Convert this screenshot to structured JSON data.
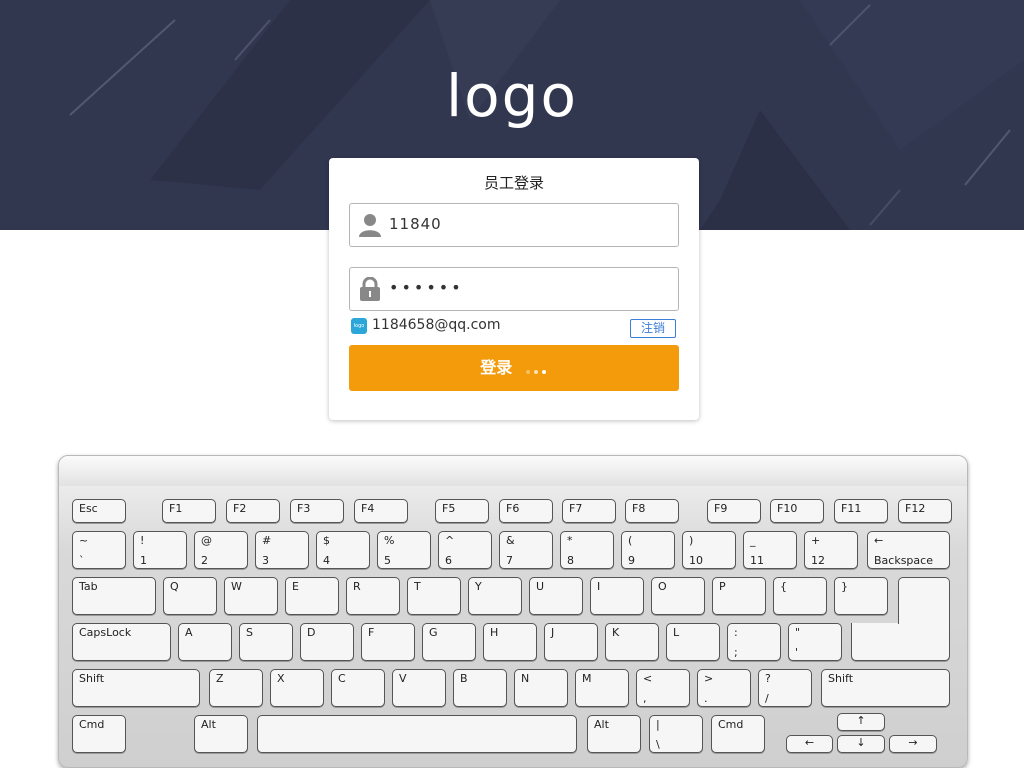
{
  "header": {
    "logo_text": "logo"
  },
  "login": {
    "title": "员工登录",
    "username_value": "11840",
    "password_mask": "••••••",
    "account_logo_text": "logo",
    "account_email": "1184658@qq.com",
    "logout_label": "注销",
    "submit_label": "登录"
  },
  "icons": {
    "user": "user-icon",
    "lock": "lock-icon",
    "loading": "loading-dots-icon"
  },
  "colors": {
    "banner": "#323750",
    "accent": "#f49b0c",
    "link": "#3d7ed9"
  },
  "keyboard": {
    "rows": [
      [
        {
          "top": "Esc",
          "name": "esc"
        },
        {
          "top": "F1",
          "name": "f1"
        },
        {
          "top": "F2",
          "name": "f2"
        },
        {
          "top": "F3",
          "name": "f3"
        },
        {
          "top": "F4",
          "name": "f4"
        },
        {
          "top": "F5",
          "name": "f5"
        },
        {
          "top": "F6",
          "name": "f6"
        },
        {
          "top": "F7",
          "name": "f7"
        },
        {
          "top": "F8",
          "name": "f8"
        },
        {
          "top": "F9",
          "name": "f9"
        },
        {
          "top": "F10",
          "name": "f10"
        },
        {
          "top": "F11",
          "name": "f11"
        },
        {
          "top": "F12",
          "name": "f12"
        }
      ],
      [
        {
          "top": "~",
          "bottom": "`",
          "name": "tilde"
        },
        {
          "top": "!",
          "bottom": "1",
          "name": "1"
        },
        {
          "top": "@",
          "bottom": "2",
          "name": "2"
        },
        {
          "top": "#",
          "bottom": "3",
          "name": "3"
        },
        {
          "top": "$",
          "bottom": "4",
          "name": "4"
        },
        {
          "top": "%",
          "bottom": "5",
          "name": "5"
        },
        {
          "top": "^",
          "bottom": "6",
          "name": "6"
        },
        {
          "top": "&",
          "bottom": "7",
          "name": "7"
        },
        {
          "top": "*",
          "bottom": "8",
          "name": "8"
        },
        {
          "top": "(",
          "bottom": "9",
          "name": "9"
        },
        {
          "top": ")",
          "bottom": "10",
          "name": "10"
        },
        {
          "top": "_",
          "bottom": "11",
          "name": "11"
        },
        {
          "top": "+",
          "bottom": "12",
          "name": "12"
        },
        {
          "top": "←",
          "bottom": "Backspace",
          "name": "backspace"
        }
      ],
      [
        {
          "top": "Tab",
          "name": "tab"
        },
        {
          "top": "Q",
          "name": "q"
        },
        {
          "top": "W",
          "name": "w"
        },
        {
          "top": "E",
          "name": "e"
        },
        {
          "top": "R",
          "name": "r"
        },
        {
          "top": "T",
          "name": "t"
        },
        {
          "top": "Y",
          "name": "y"
        },
        {
          "top": "U",
          "name": "u"
        },
        {
          "top": "I",
          "name": "i"
        },
        {
          "top": "O",
          "name": "o"
        },
        {
          "top": "P",
          "name": "p"
        },
        {
          "top": "{",
          "name": "lbrace"
        },
        {
          "top": "}",
          "name": "rbrace"
        },
        {
          "top": "",
          "name": "enter"
        }
      ],
      [
        {
          "top": "CapsLock",
          "name": "capslock"
        },
        {
          "top": "A",
          "name": "a"
        },
        {
          "top": "S",
          "name": "s"
        },
        {
          "top": "D",
          "name": "d"
        },
        {
          "top": "F",
          "name": "f"
        },
        {
          "top": "G",
          "name": "g"
        },
        {
          "top": "H",
          "name": "h"
        },
        {
          "top": "J",
          "name": "j"
        },
        {
          "top": "K",
          "name": "k"
        },
        {
          "top": "L",
          "name": "l"
        },
        {
          "top": ":",
          "bottom": ";",
          "name": "semicolon"
        },
        {
          "top": "\"",
          "bottom": "'",
          "name": "quote"
        },
        {
          "top": "",
          "name": "enter-lower"
        }
      ],
      [
        {
          "top": "Shift",
          "name": "shift-left"
        },
        {
          "top": "Z",
          "name": "z"
        },
        {
          "top": "X",
          "name": "x"
        },
        {
          "top": "C",
          "name": "c"
        },
        {
          "top": "V",
          "name": "v"
        },
        {
          "top": "B",
          "name": "b"
        },
        {
          "top": "N",
          "name": "n"
        },
        {
          "top": "M",
          "name": "m"
        },
        {
          "top": "<",
          "bottom": ",",
          "name": "comma"
        },
        {
          "top": ">",
          "bottom": ".",
          "name": "period"
        },
        {
          "top": "?",
          "bottom": "/",
          "name": "slash"
        },
        {
          "top": "Shift",
          "name": "shift-right"
        }
      ],
      [
        {
          "top": "Cmd",
          "name": "cmd-left"
        },
        {
          "top": "Alt",
          "name": "alt-left"
        },
        {
          "top": "",
          "name": "space"
        },
        {
          "top": "Alt",
          "name": "alt-right"
        },
        {
          "top": "|",
          "bottom": "\\",
          "name": "pipe"
        },
        {
          "top": "Cmd",
          "name": "cmd-right"
        },
        {
          "top": "↑",
          "name": "arrow-up"
        },
        {
          "top": "←",
          "name": "arrow-left"
        },
        {
          "top": "↓",
          "name": "arrow-down"
        },
        {
          "top": "→",
          "name": "arrow-right"
        }
      ]
    ]
  }
}
